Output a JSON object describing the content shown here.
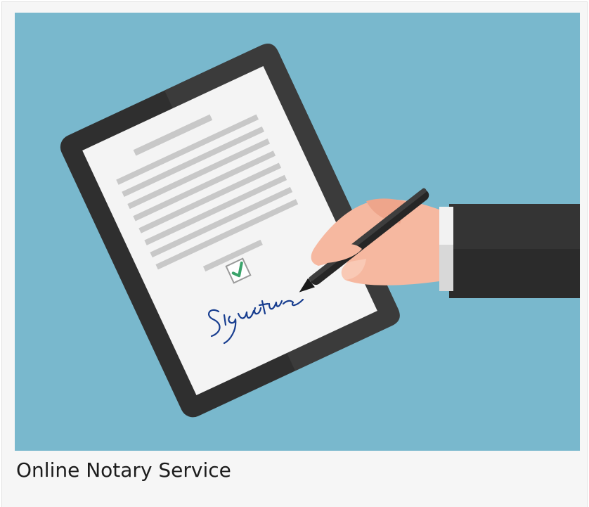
{
  "card": {
    "caption": "Online Notary Service"
  },
  "illustration": {
    "background_color": "#79b8cd",
    "tablet_color": "#2f2f2f",
    "paper_color": "#f4f4f4",
    "skin_color": "#f6b8a0",
    "sleeve_color": "#2b2b2b",
    "check_color": "#3aa36a",
    "signature_color": "#173d8f",
    "icons": [
      "tablet-icon",
      "checkbox-checked-icon",
      "signature-icon",
      "pen-icon",
      "hand-icon"
    ]
  }
}
